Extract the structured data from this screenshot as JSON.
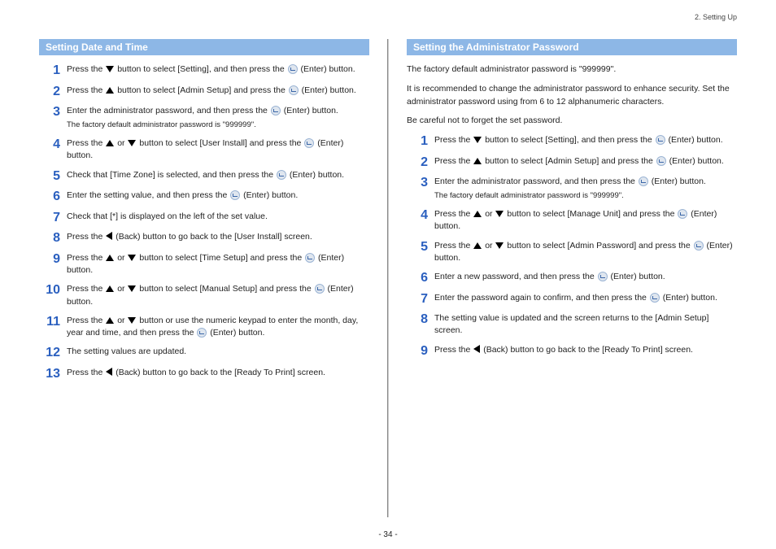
{
  "header": {
    "breadcrumb": "2. Setting Up"
  },
  "footer": {
    "page_number": "- 34 -"
  },
  "left": {
    "title": "Setting Date and Time",
    "steps": [
      {
        "n": "1",
        "parts": [
          "Press the ",
          {
            "icon": "tri-down"
          },
          " button to select [Setting], and then press the ",
          {
            "icon": "enter"
          },
          " (Enter) button."
        ]
      },
      {
        "n": "2",
        "parts": [
          "Press the ",
          {
            "icon": "tri-up"
          },
          " button to select [Admin Setup] and press the ",
          {
            "icon": "enter"
          },
          " (Enter) button."
        ]
      },
      {
        "n": "3",
        "parts": [
          "Enter the administrator password, and then press the ",
          {
            "icon": "enter"
          },
          " (Enter) button."
        ],
        "note": "The factory default administrator password is \"999999\"."
      },
      {
        "n": "4",
        "parts": [
          "Press the ",
          {
            "icon": "tri-up"
          },
          " or ",
          {
            "icon": "tri-down"
          },
          " button to select [User Install] and press the ",
          {
            "icon": "enter"
          },
          " (Enter) button."
        ]
      },
      {
        "n": "5",
        "parts": [
          "Check that [Time Zone] is selected, and then press the ",
          {
            "icon": "enter"
          },
          " (Enter) button."
        ]
      },
      {
        "n": "6",
        "parts": [
          "Enter the setting value, and then press the ",
          {
            "icon": "enter"
          },
          " (Enter) button."
        ]
      },
      {
        "n": "7",
        "parts": [
          "Check that [*] is displayed on the left of the set value."
        ]
      },
      {
        "n": "8",
        "parts": [
          "Press the ",
          {
            "icon": "tri-left"
          },
          " (Back) button to go back to the [User Install] screen."
        ]
      },
      {
        "n": "9",
        "parts": [
          "Press the ",
          {
            "icon": "tri-up"
          },
          " or ",
          {
            "icon": "tri-down"
          },
          " button to select [Time Setup] and press the ",
          {
            "icon": "enter"
          },
          " (Enter) button."
        ]
      },
      {
        "n": "10",
        "parts": [
          "Press the ",
          {
            "icon": "tri-up"
          },
          " or ",
          {
            "icon": "tri-down"
          },
          " button to select [Manual Setup] and press the ",
          {
            "icon": "enter"
          },
          " (Enter) button."
        ]
      },
      {
        "n": "11",
        "parts": [
          "Press the ",
          {
            "icon": "tri-up"
          },
          " or ",
          {
            "icon": "tri-down"
          },
          " button or use the numeric keypad to enter the month, day, year and time, and then press the ",
          {
            "icon": "enter"
          },
          " (Enter) button."
        ]
      },
      {
        "n": "12",
        "parts": [
          "The setting values are updated."
        ]
      },
      {
        "n": "13",
        "parts": [
          "Press the ",
          {
            "icon": "tri-left"
          },
          " (Back) button to go back to the [Ready To Print] screen."
        ]
      }
    ]
  },
  "right": {
    "title": "Setting the Administrator Password",
    "intro": [
      "The factory default administrator password is \"999999\".",
      "It is recommended to change the administrator password to enhance security. Set the administrator password using from 6 to 12 alphanumeric characters.",
      "Be careful not to forget the set password."
    ],
    "steps": [
      {
        "n": "1",
        "parts": [
          "Press the ",
          {
            "icon": "tri-down"
          },
          " button to select [Setting], and then press the ",
          {
            "icon": "enter"
          },
          " (Enter) button."
        ]
      },
      {
        "n": "2",
        "parts": [
          "Press the ",
          {
            "icon": "tri-up"
          },
          " button to select [Admin Setup] and press the ",
          {
            "icon": "enter"
          },
          " (Enter) button."
        ]
      },
      {
        "n": "3",
        "parts": [
          "Enter the administrator password, and then press the ",
          {
            "icon": "enter"
          },
          " (Enter) button."
        ],
        "note": "The factory default administrator password is \"999999\"."
      },
      {
        "n": "4",
        "parts": [
          "Press the ",
          {
            "icon": "tri-up"
          },
          " or ",
          {
            "icon": "tri-down"
          },
          " button to select [Manage Unit] and press the ",
          {
            "icon": "enter"
          },
          " (Enter) button."
        ]
      },
      {
        "n": "5",
        "parts": [
          "Press the ",
          {
            "icon": "tri-up"
          },
          " or ",
          {
            "icon": "tri-down"
          },
          " button to select [Admin Password] and press the ",
          {
            "icon": "enter"
          },
          " (Enter) button."
        ]
      },
      {
        "n": "6",
        "parts": [
          "Enter a new password, and then press the ",
          {
            "icon": "enter"
          },
          " (Enter) button."
        ]
      },
      {
        "n": "7",
        "parts": [
          "Enter the password again to confirm, and then press the ",
          {
            "icon": "enter"
          },
          " (Enter) button."
        ]
      },
      {
        "n": "8",
        "parts": [
          "The setting value is updated and the screen returns to the [Admin Setup] screen."
        ]
      },
      {
        "n": "9",
        "parts": [
          "Press the ",
          {
            "icon": "tri-left"
          },
          " (Back) button to go back to the [Ready To Print] screen."
        ]
      }
    ]
  }
}
